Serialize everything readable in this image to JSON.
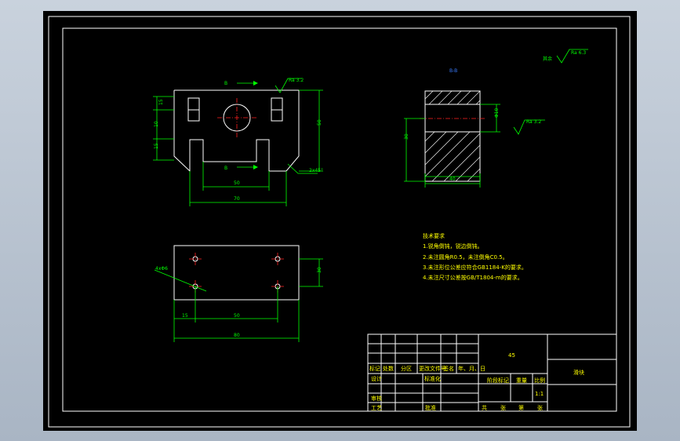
{
  "drawing": {
    "roughness_default": "Ra 6.3",
    "roughness_default_prefix": "其余",
    "roughness_top": "Ra 3.2",
    "roughness_side": "Ra 3.2",
    "section_label_top": "B",
    "section_label_bottom": "B",
    "section_view_label": "B-B",
    "chamfer_label": "2x45°",
    "dims": {
      "front_h1": "15",
      "front_h2": "10",
      "front_h3": "15",
      "front_total_h": "50",
      "front_inner_w": "50",
      "front_total_w": "70",
      "section_h": "30",
      "section_w": "40",
      "section_hole": "Φ10",
      "top_h": "30",
      "top_left": "15",
      "top_mid": "50",
      "top_total": "80",
      "top_phi": "4xΦ6"
    },
    "notes": {
      "title": "技术要求",
      "items": [
        "1.锐角倒钝，锐边倒钝。",
        "2.未注圆角R0.5，未注倒角C0.5。",
        "3.未注形位公差应符合GB1184-K的要求。",
        "4.未注尺寸公差按GB/T1804-m的要求。"
      ]
    }
  },
  "title_block": {
    "material": "45",
    "part_name": "滑块",
    "scale": "1:1",
    "row_labels": [
      "标记",
      "处数",
      "分区",
      "更改文件号",
      "签名",
      "年、月、日"
    ],
    "design": "设计",
    "standardize": "标准化",
    "review": "审核",
    "process": "工艺",
    "approve": "批准",
    "stage_mark": "阶段标记",
    "weight": "重量",
    "ratio": "比例",
    "sheet_total": "共",
    "sheet_zhang": "张",
    "sheet_no": "第",
    "sheet_zhang2": "张"
  }
}
